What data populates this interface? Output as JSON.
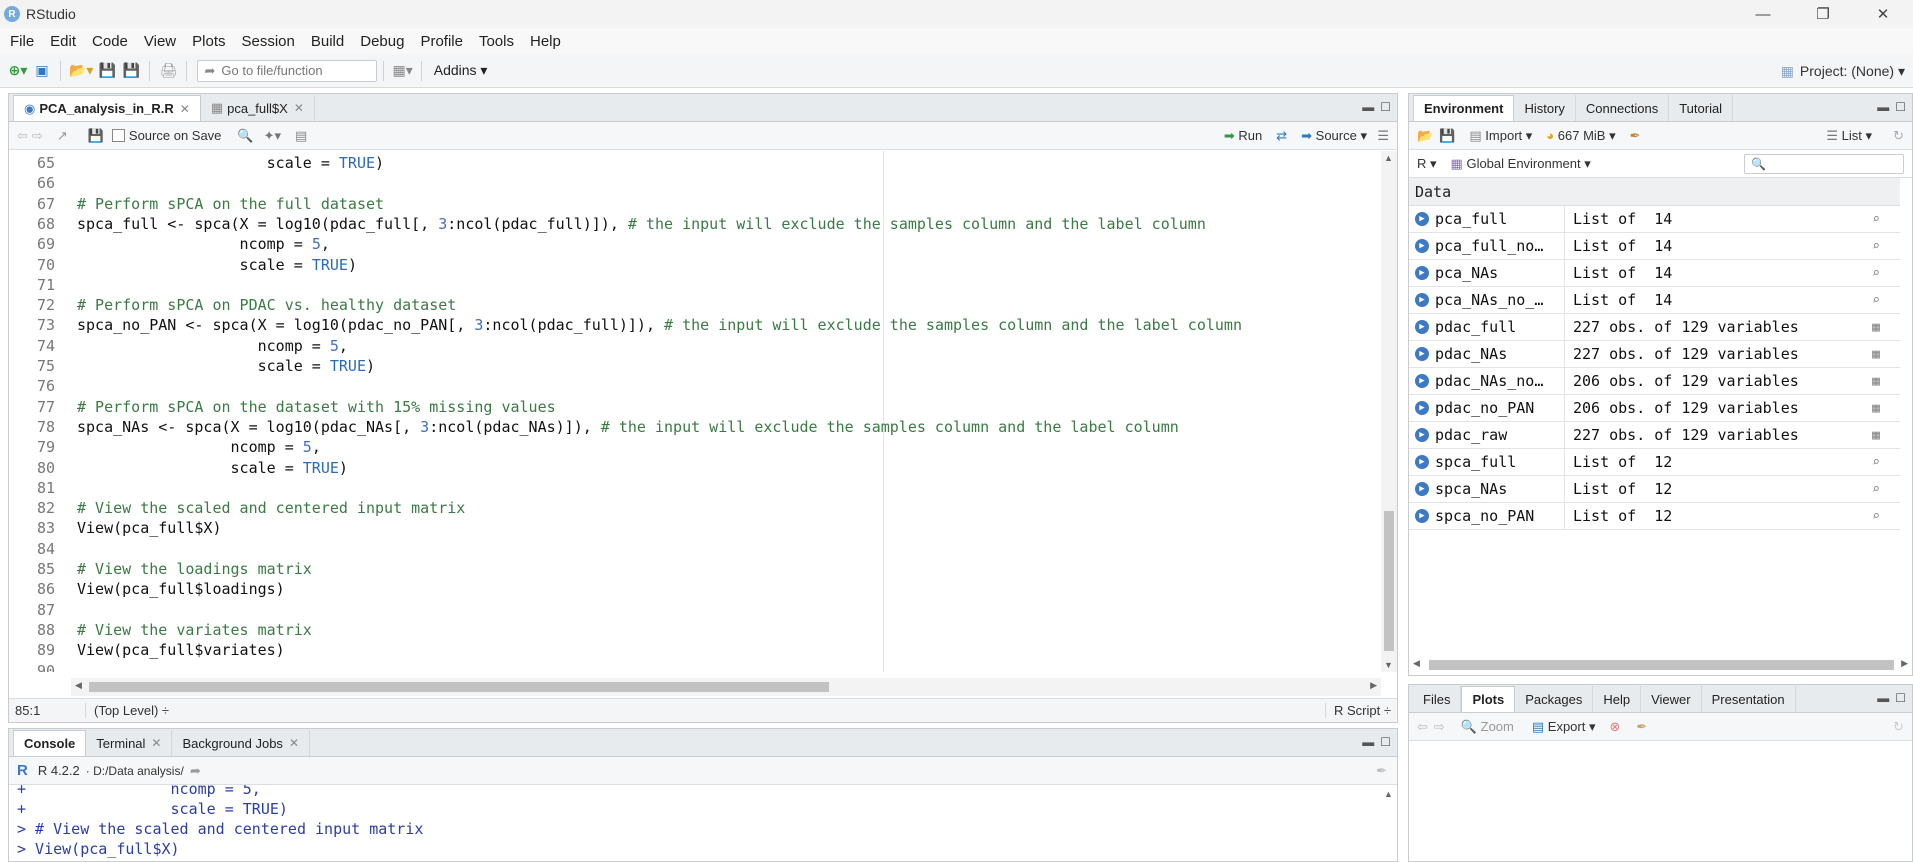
{
  "window": {
    "title": "RStudio",
    "logo_letter": "R",
    "minimize_icon": "minimize-icon",
    "restore_icon": "restore-icon",
    "close_icon": "close-icon"
  },
  "menu": [
    "File",
    "Edit",
    "Code",
    "View",
    "Plots",
    "Session",
    "Build",
    "Debug",
    "Profile",
    "Tools",
    "Help"
  ],
  "toolbar": {
    "goto_placeholder": "Go to file/function",
    "addins_label": "Addins",
    "project_label": "Project: (None)"
  },
  "editor": {
    "tabs": [
      {
        "label": "PCA_analysis_in_R.R",
        "active": true
      },
      {
        "label": "pca_full$X",
        "active": false
      }
    ],
    "source_on_save": "Source on Save",
    "run_label": "Run",
    "source_label": "Source",
    "lines": [
      {
        "n": "65",
        "segments": [
          {
            "t": "                     scale = ",
            "c": ""
          },
          {
            "t": "TRUE",
            "c": "kw"
          },
          {
            "t": ")",
            "c": ""
          }
        ]
      },
      {
        "n": "66",
        "segments": []
      },
      {
        "n": "67",
        "segments": [
          {
            "t": "# Perform sPCA on the full dataset",
            "c": "cmt"
          }
        ]
      },
      {
        "n": "68",
        "segments": [
          {
            "t": "spca_full <- spca(X = log10(pdac_full[, ",
            "c": ""
          },
          {
            "t": "3",
            "c": "num"
          },
          {
            "t": ":ncol(pdac_full)]), ",
            "c": ""
          },
          {
            "t": "# the input will exclude the samples column and the label column",
            "c": "cmt"
          }
        ]
      },
      {
        "n": "69",
        "segments": [
          {
            "t": "                  ncomp = ",
            "c": ""
          },
          {
            "t": "5",
            "c": "num"
          },
          {
            "t": ",",
            "c": ""
          }
        ]
      },
      {
        "n": "70",
        "segments": [
          {
            "t": "                  scale = ",
            "c": ""
          },
          {
            "t": "TRUE",
            "c": "kw"
          },
          {
            "t": ")",
            "c": ""
          }
        ]
      },
      {
        "n": "71",
        "segments": []
      },
      {
        "n": "72",
        "segments": [
          {
            "t": "# Perform sPCA on PDAC vs. healthy dataset",
            "c": "cmt"
          }
        ]
      },
      {
        "n": "73",
        "segments": [
          {
            "t": "spca_no_PAN <- spca(X = log10(pdac_no_PAN[, ",
            "c": ""
          },
          {
            "t": "3",
            "c": "num"
          },
          {
            "t": ":ncol(pdac_full)]), ",
            "c": ""
          },
          {
            "t": "# the input will exclude the samples column and the label column",
            "c": "cmt"
          }
        ]
      },
      {
        "n": "74",
        "segments": [
          {
            "t": "                    ncomp = ",
            "c": ""
          },
          {
            "t": "5",
            "c": "num"
          },
          {
            "t": ",",
            "c": ""
          }
        ]
      },
      {
        "n": "75",
        "segments": [
          {
            "t": "                    scale = ",
            "c": ""
          },
          {
            "t": "TRUE",
            "c": "kw"
          },
          {
            "t": ")",
            "c": ""
          }
        ]
      },
      {
        "n": "76",
        "segments": []
      },
      {
        "n": "77",
        "segments": [
          {
            "t": "# Perform sPCA on the dataset with 15% missing values",
            "c": "cmt"
          }
        ]
      },
      {
        "n": "78",
        "segments": [
          {
            "t": "spca_NAs <- spca(X = log10(pdac_NAs[, ",
            "c": ""
          },
          {
            "t": "3",
            "c": "num"
          },
          {
            "t": ":ncol(pdac_NAs)]), ",
            "c": ""
          },
          {
            "t": "# the input will exclude the samples column and the label column",
            "c": "cmt"
          }
        ]
      },
      {
        "n": "79",
        "segments": [
          {
            "t": "                 ncomp = ",
            "c": ""
          },
          {
            "t": "5",
            "c": "num"
          },
          {
            "t": ",",
            "c": ""
          }
        ]
      },
      {
        "n": "80",
        "segments": [
          {
            "t": "                 scale = ",
            "c": ""
          },
          {
            "t": "TRUE",
            "c": "kw"
          },
          {
            "t": ")",
            "c": ""
          }
        ]
      },
      {
        "n": "81",
        "segments": []
      },
      {
        "n": "82",
        "segments": [
          {
            "t": "# View the scaled and centered input matrix",
            "c": "cmt"
          }
        ]
      },
      {
        "n": "83",
        "segments": [
          {
            "t": "View(pca_full$X)",
            "c": ""
          }
        ]
      },
      {
        "n": "84",
        "segments": []
      },
      {
        "n": "85",
        "segments": [
          {
            "t": "# View the loadings matrix",
            "c": "cmt"
          }
        ]
      },
      {
        "n": "86",
        "segments": [
          {
            "t": "View(pca_full$loadings)",
            "c": ""
          }
        ]
      },
      {
        "n": "87",
        "segments": []
      },
      {
        "n": "88",
        "segments": [
          {
            "t": "# View the variates matrix",
            "c": "cmt"
          }
        ]
      },
      {
        "n": "89",
        "segments": [
          {
            "t": "View(pca_full$variates)",
            "c": ""
          }
        ]
      },
      {
        "n": "90",
        "segments": []
      }
    ],
    "status": {
      "position": "85:1",
      "scope": "(Top Level) ÷",
      "filetype": "R Script ÷"
    }
  },
  "console": {
    "tabs": [
      {
        "label": "Console",
        "active": true
      },
      {
        "label": "Terminal",
        "active": false
      },
      {
        "label": "Background Jobs",
        "active": false
      }
    ],
    "r_version": "R 4.2.2",
    "working_dir": "· D:/Data analysis/",
    "lines": [
      "+                ncomp = 5,",
      "+                scale = TRUE)",
      "> # View the scaled and centered input matrix",
      "> View(pca_full$X)"
    ]
  },
  "environment": {
    "tabs": [
      {
        "label": "Environment",
        "active": true
      },
      {
        "label": "History",
        "active": false
      },
      {
        "label": "Connections",
        "active": false
      },
      {
        "label": "Tutorial",
        "active": false
      }
    ],
    "import_label": "Import",
    "memory_label": "667 MiB",
    "list_label": "List",
    "language": "R",
    "scope": "Global Environment",
    "section_header": "Data",
    "rows": [
      {
        "name": "pca_full",
        "value": "List of  14",
        "action": "magnifier-icon"
      },
      {
        "name": "pca_full_no…",
        "value": "List of  14",
        "action": "magnifier-icon"
      },
      {
        "name": "pca_NAs",
        "value": "List of  14",
        "action": "magnifier-icon"
      },
      {
        "name": "pca_NAs_no_…",
        "value": "List of  14",
        "action": "magnifier-icon"
      },
      {
        "name": "pdac_full",
        "value": "227 obs. of 129 variables",
        "action": "grid-icon"
      },
      {
        "name": "pdac_NAs",
        "value": "227 obs. of 129 variables",
        "action": "grid-icon"
      },
      {
        "name": "pdac_NAs_no…",
        "value": "206 obs. of 129 variables",
        "action": "grid-icon"
      },
      {
        "name": "pdac_no_PAN",
        "value": "206 obs. of 129 variables",
        "action": "grid-icon"
      },
      {
        "name": "pdac_raw",
        "value": "227 obs. of 129 variables",
        "action": "grid-icon"
      },
      {
        "name": "spca_full",
        "value": "List of  12",
        "action": "magnifier-icon"
      },
      {
        "name": "spca_NAs",
        "value": "List of  12",
        "action": "magnifier-icon"
      },
      {
        "name": "spca_no_PAN",
        "value": "List of  12",
        "action": "magnifier-icon"
      }
    ]
  },
  "files": {
    "tabs": [
      {
        "label": "Files",
        "active": false
      },
      {
        "label": "Plots",
        "active": true
      },
      {
        "label": "Packages",
        "active": false
      },
      {
        "label": "Help",
        "active": false
      },
      {
        "label": "Viewer",
        "active": false
      },
      {
        "label": "Presentation",
        "active": false
      }
    ],
    "zoom_label": "Zoom",
    "export_label": "Export"
  },
  "colors": {
    "accent": "#3d79c4",
    "comment": "#3a7a43",
    "number": "#3b6fc4"
  }
}
